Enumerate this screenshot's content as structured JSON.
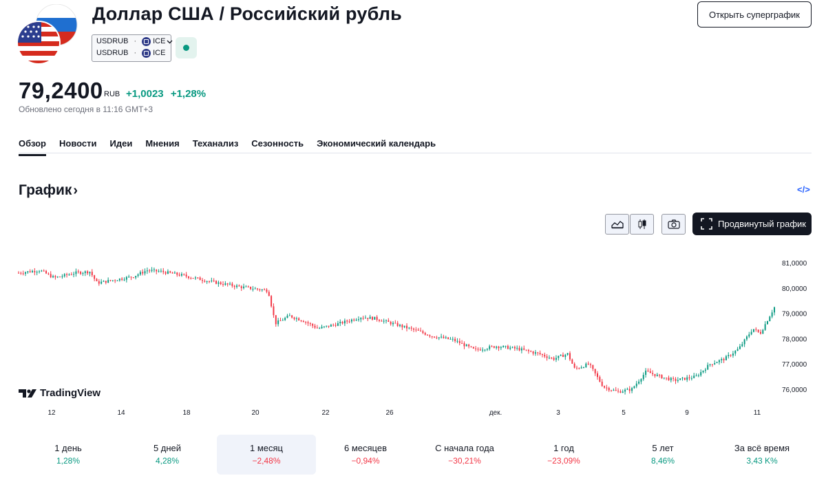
{
  "header": {
    "title": "Доллар США / Российский рубль",
    "symbols": [
      {
        "ticker": "USDRUB",
        "exchange": "ICE"
      },
      {
        "ticker": "USDRUB",
        "exchange": "ICE"
      }
    ],
    "separator": "·",
    "open_supergraph": "Открыть суперграфик"
  },
  "quote": {
    "price": "79,2400",
    "currency": "RUB",
    "change": "+1,0023",
    "change_pct": "+1,28%",
    "updated": "Обновлено сегодня в 11:16 GMT+3"
  },
  "tabs": [
    {
      "label": "Обзор",
      "active": true
    },
    {
      "label": "Новости",
      "active": false
    },
    {
      "label": "Идеи",
      "active": false
    },
    {
      "label": "Мнения",
      "active": false
    },
    {
      "label": "Теханализ",
      "active": false
    },
    {
      "label": "Сезонность",
      "active": false
    },
    {
      "label": "Экономический календарь",
      "active": false
    }
  ],
  "section": {
    "title": "График",
    "arrow": "›",
    "embed": "</>"
  },
  "toolbar": {
    "advanced_chart": "Продвинутый график"
  },
  "brand": {
    "name": "TradingView"
  },
  "colors": {
    "up": "#089981",
    "down": "#f23645",
    "text": "#131722"
  },
  "chart_data": {
    "type": "candlestick",
    "y_ticks": [
      "81,0000",
      "80,0000",
      "79,0000",
      "78,0000",
      "77,0000",
      "76,0000"
    ],
    "y_tick_values": [
      81,
      80,
      79,
      78,
      77,
      76
    ],
    "ylim": [
      75.4,
      81.6
    ],
    "x_ticks": [
      "12",
      "14",
      "18",
      "20",
      "22",
      "26",
      "дек.",
      "3",
      "5",
      "9",
      "11"
    ],
    "grid": false,
    "trend_close": [
      [
        0,
        80.6
      ],
      [
        3,
        80.7
      ],
      [
        5,
        80.4
      ],
      [
        8,
        80.6
      ],
      [
        10,
        80.65
      ],
      [
        11,
        80.2
      ],
      [
        14,
        80.35
      ],
      [
        16,
        80.45
      ],
      [
        18,
        80.7
      ],
      [
        20,
        80.65
      ],
      [
        23,
        80.5
      ],
      [
        27,
        80.25
      ],
      [
        31,
        80.05
      ],
      [
        35,
        79.9
      ],
      [
        36,
        78.6
      ],
      [
        38,
        78.9
      ],
      [
        40,
        78.7
      ],
      [
        42,
        78.4
      ],
      [
        45,
        78.6
      ],
      [
        48,
        78.85
      ],
      [
        50,
        78.8
      ],
      [
        53,
        78.55
      ],
      [
        56,
        78.3
      ],
      [
        58,
        78.1
      ],
      [
        61,
        77.95
      ],
      [
        64,
        77.55
      ],
      [
        67,
        77.7
      ],
      [
        70,
        77.6
      ],
      [
        73,
        77.4
      ],
      [
        75,
        77.2
      ],
      [
        77,
        77.4
      ],
      [
        78,
        76.8
      ],
      [
        80,
        77.0
      ],
      [
        82,
        76.1
      ],
      [
        84,
        75.9
      ],
      [
        86,
        76.0
      ],
      [
        88,
        76.7
      ],
      [
        90,
        76.5
      ],
      [
        92,
        76.35
      ],
      [
        95,
        76.5
      ],
      [
        97,
        77.0
      ],
      [
        99,
        77.2
      ],
      [
        101,
        77.6
      ],
      [
        103,
        78.4
      ],
      [
        104,
        78.2
      ],
      [
        106,
        79.24
      ]
    ]
  },
  "periods": [
    {
      "label": "1 день",
      "value": "1,28%",
      "dir": "up",
      "active": false
    },
    {
      "label": "5 дней",
      "value": "4,28%",
      "dir": "up",
      "active": false
    },
    {
      "label": "1 месяц",
      "value": "−2,48%",
      "dir": "down",
      "active": true
    },
    {
      "label": "6 месяцев",
      "value": "−0,94%",
      "dir": "down",
      "active": false
    },
    {
      "label": "С начала года",
      "value": "−30,21%",
      "dir": "down",
      "active": false
    },
    {
      "label": "1 год",
      "value": "−23,09%",
      "dir": "down",
      "active": false
    },
    {
      "label": "5 лет",
      "value": "8,46%",
      "dir": "up",
      "active": false
    },
    {
      "label": "За всё время",
      "value": "3,43 K%",
      "dir": "up",
      "active": false
    }
  ]
}
